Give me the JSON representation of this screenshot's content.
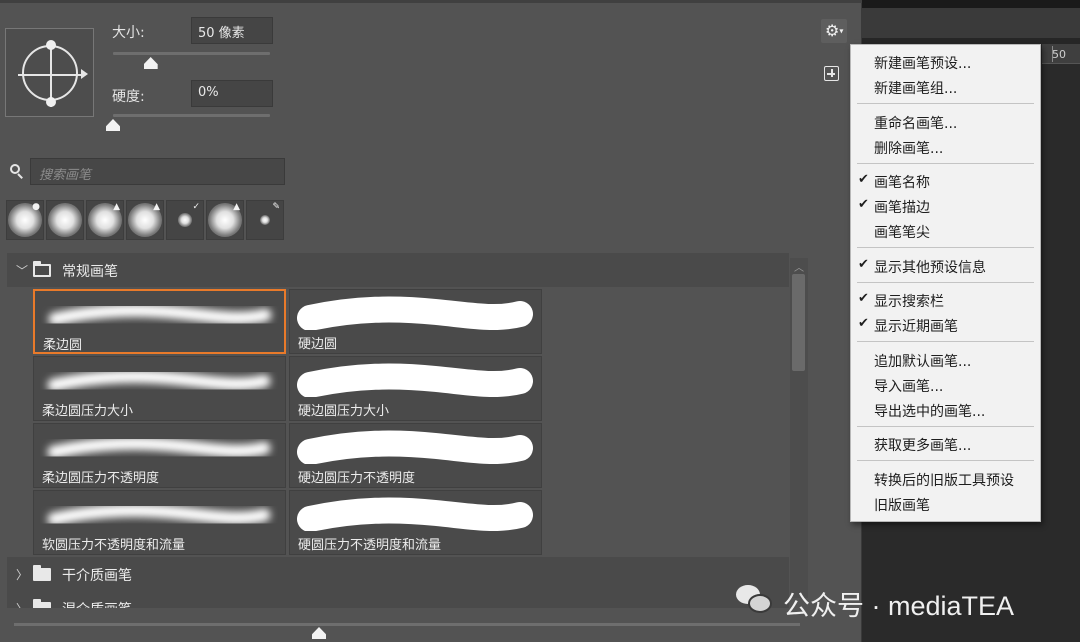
{
  "panel": {
    "size_label": "大小:",
    "size_value": "50 像素",
    "size_fraction": 0.24,
    "hardness_label": "硬度:",
    "hardness_value": "0%",
    "hardness_fraction": 0.0,
    "search_placeholder": "搜索画笔"
  },
  "recent_brushes": [
    {
      "name": "soft-round-wet",
      "badge": "droplet"
    },
    {
      "name": "soft-round",
      "badge": ""
    },
    {
      "name": "soft-round-user",
      "badge": "user"
    },
    {
      "name": "soft-round-user-small",
      "badge": "user-k"
    },
    {
      "name": "small-soft-airbrush",
      "badge": "airbrush"
    },
    {
      "name": "soft-round-user-2",
      "badge": "user"
    },
    {
      "name": "small-dot-pen",
      "badge": "pen"
    }
  ],
  "groups": [
    {
      "name": "常规画笔",
      "expanded": true
    },
    {
      "name": "干介质画笔",
      "expanded": false
    },
    {
      "name": "湿介质画笔",
      "expanded": false
    }
  ],
  "brushes": [
    {
      "name": "柔边圆",
      "type": "soft",
      "selected": true
    },
    {
      "name": "硬边圆",
      "type": "hard",
      "selected": false
    },
    {
      "name": "柔边圆压力大小",
      "type": "soft",
      "selected": false
    },
    {
      "name": "硬边圆压力大小",
      "type": "hard",
      "selected": false
    },
    {
      "name": "柔边圆压力不透明度",
      "type": "soft",
      "selected": false
    },
    {
      "name": "硬边圆压力不透明度",
      "type": "hard",
      "selected": false
    },
    {
      "name": "软圆压力不透明度和流量",
      "type": "soft",
      "selected": false
    },
    {
      "name": "硬圆压力不透明度和流量",
      "type": "hard",
      "selected": false
    }
  ],
  "menu": {
    "items": [
      {
        "label": "新建画笔预设...",
        "checked": false
      },
      {
        "label": "新建画笔组...",
        "checked": false
      },
      {
        "label": "重命名画笔...",
        "checked": false
      },
      {
        "label": "删除画笔...",
        "checked": false
      },
      {
        "label": "画笔名称",
        "checked": true
      },
      {
        "label": "画笔描边",
        "checked": true
      },
      {
        "label": "画笔笔尖",
        "checked": false
      },
      {
        "label": "显示其他预设信息",
        "checked": true
      },
      {
        "label": "显示搜索栏",
        "checked": true
      },
      {
        "label": "显示近期画笔",
        "checked": true
      },
      {
        "label": "追加默认画笔...",
        "checked": false
      },
      {
        "label": "导入画笔...",
        "checked": false
      },
      {
        "label": "导出选中的画笔...",
        "checked": false
      },
      {
        "label": "获取更多画笔...",
        "checked": false
      },
      {
        "label": "转换后的旧版工具预设",
        "checked": false
      },
      {
        "label": "旧版画笔",
        "checked": false
      }
    ],
    "check_mark": "✔"
  },
  "ruler": {
    "value": "50"
  },
  "watermark": {
    "text": "公众号 · mediaTEA"
  },
  "colors": {
    "panel_bg": "#535353",
    "selection_outline": "#e97a2a",
    "menu_bg": "#f2f2f2"
  }
}
